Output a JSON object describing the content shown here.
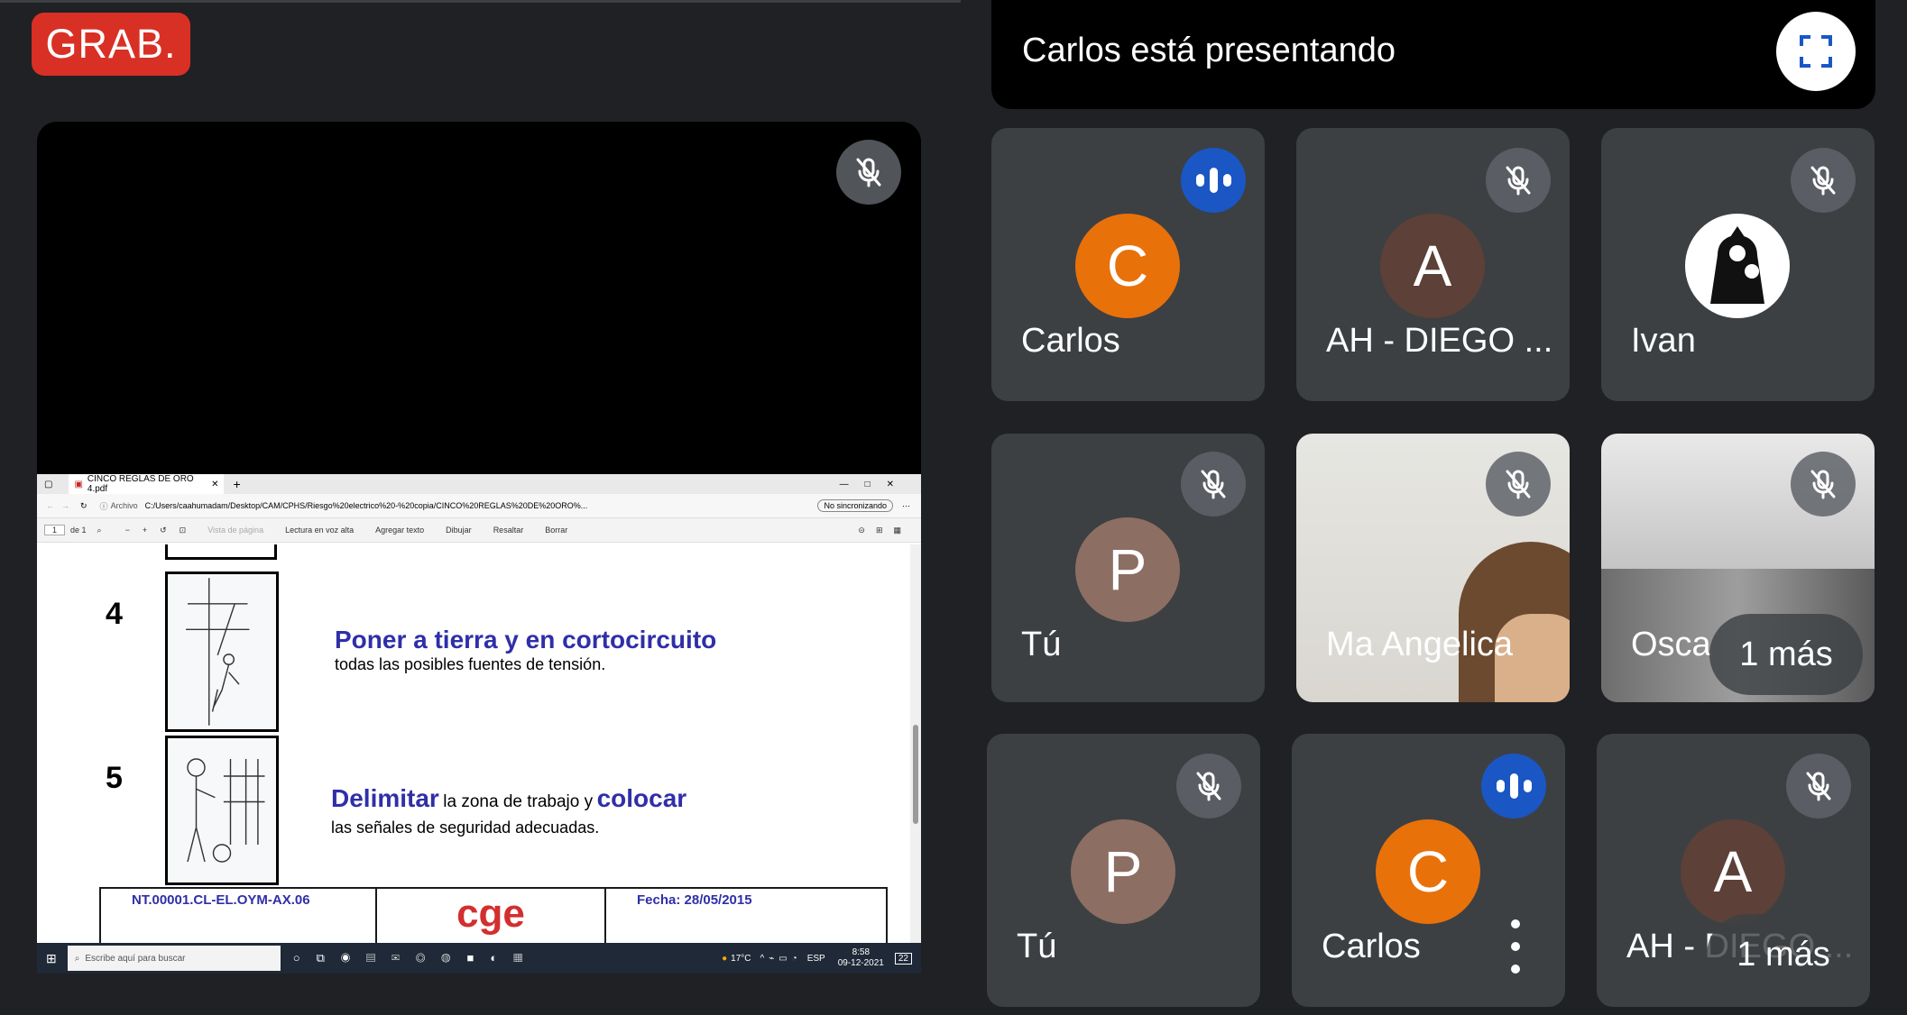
{
  "recording_badge": "GRAB.",
  "presenter_banner": "Carlos está presentando",
  "participants": [
    {
      "name": "Carlos",
      "initial": "C",
      "avatar_color": "#e8710a",
      "state": "speaking"
    },
    {
      "name": "AH - DIEGO ...",
      "initial": "A",
      "avatar_color": "#5d4037",
      "state": "muted"
    },
    {
      "name": "Ivan",
      "initial": "",
      "avatar_color": "#ffffff",
      "state": "muted"
    },
    {
      "name": "Tú",
      "initial": "P",
      "avatar_color": "#8d6e63",
      "state": "muted"
    },
    {
      "name": "Ma Angelica",
      "initial": "",
      "avatar_color": "#c9b79c",
      "state": "muted"
    },
    {
      "name": "Osca",
      "initial": "",
      "avatar_color": "#9aa0a6",
      "state": "muted",
      "more_label": "1 más"
    },
    {
      "name": "Tú",
      "initial": "P",
      "avatar_color": "#8d6e63",
      "state": "muted"
    },
    {
      "name": "Carlos",
      "initial": "C",
      "avatar_color": "#e8710a",
      "state": "speaking"
    },
    {
      "name": "AH - DIEGO ...",
      "initial": "A",
      "avatar_color": "#5d4037",
      "state": "muted",
      "more_label": "1 más"
    }
  ],
  "browser": {
    "tab_title": "CINCO REGLAS DE ORO 4.pdf",
    "address_prefix": "Archivo",
    "url": "C:/Users/caahumadam/Desktop/CAM/CPHS/Riesgo%20electrico%20-%20copia/CINCO%20REGLAS%20DE%20ORO%...",
    "sync_label": "No sincronizando",
    "page_num": "1",
    "page_of": "de 1",
    "toolbar": [
      "Vista de página",
      "Lectura en voz alta",
      "Agregar texto",
      "Dibujar",
      "Resaltar",
      "Borrar"
    ]
  },
  "document": {
    "rule4_num": "4",
    "rule4_title": "Poner a tierra y en cortocircuito",
    "rule4_text": "todas las posibles fuentes de tensión.",
    "rule5_num": "5",
    "rule5_word1": "Delimitar",
    "rule5_mid": "la zona de trabajo y",
    "rule5_word2": "colocar",
    "rule5_text": "las señales de seguridad adecuadas.",
    "footer_code": "NT.00001.CL-EL.OYM-AX.06",
    "footer_logo": "cge",
    "footer_date": "Fecha: 28/05/2015"
  },
  "taskbar": {
    "search_placeholder": "Escribe aquí para buscar",
    "weather": "17°C",
    "lang": "ESP",
    "time": "8:58",
    "date": "09-12-2021",
    "notifications": "22"
  },
  "colors": {
    "background": "#202124",
    "tile": "#3c4043",
    "record": "#d93025",
    "speaking": "#1a57c4",
    "doc_blue": "#2f2fa8"
  }
}
